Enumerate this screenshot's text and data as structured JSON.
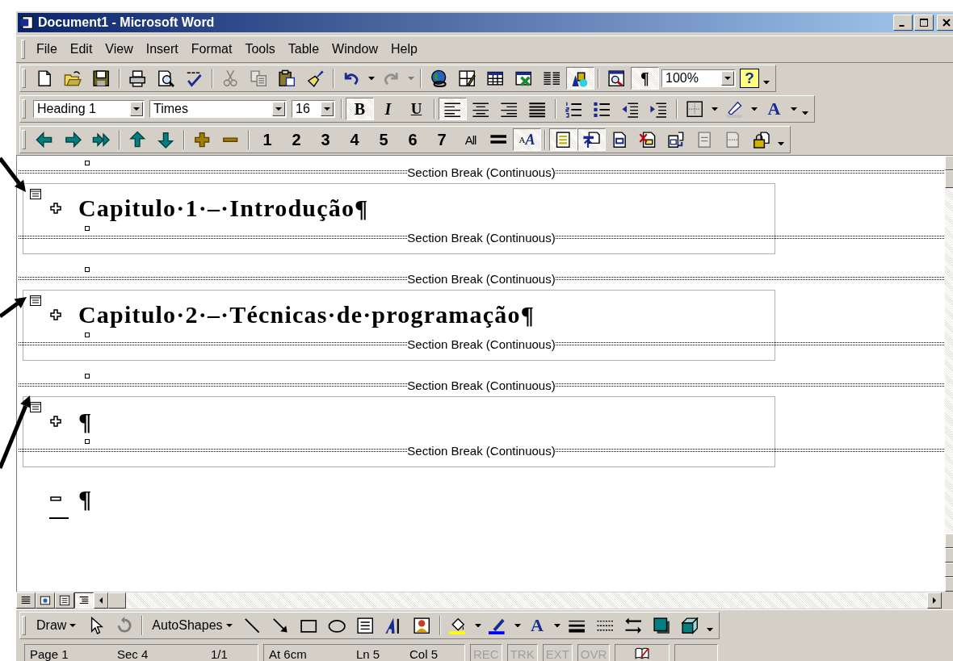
{
  "window": {
    "title": "Document1 - Microsoft Word"
  },
  "menu": [
    "File",
    "Edit",
    "View",
    "Insert",
    "Format",
    "Tools",
    "Table",
    "Window",
    "Help"
  ],
  "toolbars": [
    {
      "kind": "standard",
      "items": [
        {
          "kind": "new",
          "pressed": false,
          "disabled": false
        },
        {
          "kind": "open",
          "pressed": false,
          "disabled": false
        },
        {
          "kind": "save",
          "pressed": false,
          "disabled": false
        },
        {
          "kind": "sep"
        },
        {
          "kind": "print",
          "pressed": false,
          "disabled": false
        },
        {
          "kind": "preview",
          "pressed": false,
          "disabled": false
        },
        {
          "kind": "spell",
          "pressed": false,
          "disabled": false
        },
        {
          "kind": "sep"
        },
        {
          "kind": "cut",
          "pressed": false,
          "disabled": true
        },
        {
          "kind": "copy",
          "pressed": false,
          "disabled": true
        },
        {
          "kind": "paste",
          "pressed": false,
          "disabled": false
        },
        {
          "kind": "painter",
          "pressed": false,
          "disabled": false
        },
        {
          "kind": "sep"
        },
        {
          "kind": "undo",
          "pressed": false,
          "disabled": false
        },
        {
          "kind": "dropdown",
          "pressed": false,
          "disabled": false
        },
        {
          "kind": "redo",
          "pressed": false,
          "disabled": true
        },
        {
          "kind": "dropdown",
          "pressed": false,
          "disabled": true
        },
        {
          "kind": "sep"
        },
        {
          "kind": "web",
          "pressed": false,
          "disabled": false
        },
        {
          "kind": "tables",
          "pressed": false,
          "disabled": false
        },
        {
          "kind": "table",
          "pressed": false,
          "disabled": false
        },
        {
          "kind": "excel",
          "pressed": false,
          "disabled": false
        },
        {
          "kind": "columns",
          "pressed": false,
          "disabled": false
        },
        {
          "kind": "drawing",
          "pressed": true,
          "disabled": false
        },
        {
          "kind": "sep"
        },
        {
          "kind": "docmap",
          "pressed": false,
          "disabled": false
        },
        {
          "kind": "pilcrow",
          "label": "¶",
          "pressed": true,
          "disabled": false
        },
        {
          "kind": "zoom",
          "value": "100%"
        },
        {
          "kind": "help",
          "label": "?",
          "pressed": false,
          "disabled": false
        },
        {
          "kind": "more",
          "pressed": false,
          "disabled": false
        }
      ]
    },
    {
      "kind": "formatting",
      "items": [
        {
          "kind": "style",
          "value": "Heading 1"
        },
        {
          "kind": "font",
          "value": "Times"
        },
        {
          "kind": "size",
          "value": "16"
        },
        {
          "kind": "sep"
        },
        {
          "kind": "bold",
          "label": "B",
          "pressed": true,
          "disabled": false
        },
        {
          "kind": "italic",
          "label": "I",
          "pressed": false,
          "disabled": false
        },
        {
          "kind": "underline",
          "label": "U",
          "pressed": false,
          "disabled": false
        },
        {
          "kind": "sep"
        },
        {
          "kind": "align_left",
          "pressed": true,
          "disabled": false
        },
        {
          "kind": "align_center",
          "pressed": false,
          "disabled": false
        },
        {
          "kind": "align_right",
          "pressed": false,
          "disabled": false
        },
        {
          "kind": "justify",
          "pressed": false,
          "disabled": false
        },
        {
          "kind": "sep"
        },
        {
          "kind": "numbering",
          "pressed": false,
          "disabled": false
        },
        {
          "kind": "bullets",
          "pressed": false,
          "disabled": false
        },
        {
          "kind": "outdent",
          "pressed": false,
          "disabled": false
        },
        {
          "kind": "indent",
          "pressed": false,
          "disabled": false
        },
        {
          "kind": "sep"
        },
        {
          "kind": "border",
          "pressed": false,
          "disabled": false
        },
        {
          "kind": "dropdown",
          "pressed": false,
          "disabled": false
        },
        {
          "kind": "highlight",
          "pressed": false,
          "disabled": false
        },
        {
          "kind": "dropdown",
          "pressed": false,
          "disabled": false
        },
        {
          "kind": "fontcolor",
          "label": "A",
          "pressed": false,
          "disabled": false
        },
        {
          "kind": "dropdown",
          "pressed": false,
          "disabled": false
        },
        {
          "kind": "more",
          "pressed": false,
          "disabled": false
        }
      ]
    },
    {
      "kind": "outlining",
      "items": [
        {
          "kind": "promote",
          "pressed": false,
          "disabled": false
        },
        {
          "kind": "demote",
          "pressed": false,
          "disabled": false
        },
        {
          "kind": "body",
          "pressed": false,
          "disabled": false
        },
        {
          "kind": "sep"
        },
        {
          "kind": "up",
          "pressed": false,
          "disabled": false
        },
        {
          "kind": "down",
          "pressed": false,
          "disabled": false
        },
        {
          "kind": "sep"
        },
        {
          "kind": "expand",
          "pressed": false,
          "disabled": false
        },
        {
          "kind": "collapse",
          "pressed": false,
          "disabled": false
        },
        {
          "kind": "sep"
        },
        {
          "kind": "level",
          "label": "1",
          "pressed": false,
          "disabled": false
        },
        {
          "kind": "level",
          "label": "2",
          "pressed": false,
          "disabled": false
        },
        {
          "kind": "level",
          "label": "3",
          "pressed": false,
          "disabled": false
        },
        {
          "kind": "level",
          "label": "4",
          "pressed": false,
          "disabled": false
        },
        {
          "kind": "level",
          "label": "5",
          "pressed": false,
          "disabled": false
        },
        {
          "kind": "level",
          "label": "6",
          "pressed": false,
          "disabled": false
        },
        {
          "kind": "level",
          "label": "7",
          "pressed": false,
          "disabled": false
        },
        {
          "kind": "all",
          "label": "All",
          "pressed": false,
          "disabled": false
        },
        {
          "kind": "firstline",
          "pressed": false,
          "disabled": false
        },
        {
          "kind": "format",
          "label": "$^{A}$*A*",
          "pressed": true,
          "disabled": false
        },
        {
          "kind": "sep"
        },
        {
          "kind": "master",
          "pressed": true,
          "disabled": false
        },
        {
          "kind": "collapse_sub",
          "pressed": true,
          "disabled": false
        },
        {
          "kind": "create",
          "pressed": false,
          "disabled": false
        },
        {
          "kind": "remove",
          "pressed": false,
          "disabled": false
        },
        {
          "kind": "insert",
          "pressed": false,
          "disabled": false
        },
        {
          "kind": "merge",
          "pressed": false,
          "disabled": true
        },
        {
          "kind": "split",
          "pressed": false,
          "disabled": true
        },
        {
          "kind": "lock",
          "pressed": false,
          "disabled": false
        },
        {
          "kind": "more",
          "pressed": false,
          "disabled": false
        }
      ]
    },
    {
      "kind": "drawing",
      "items": [
        {
          "kind": "menu",
          "label": "Draw"
        },
        {
          "kind": "pointer",
          "pressed": false,
          "disabled": false
        },
        {
          "kind": "rotate",
          "pressed": false,
          "disabled": true
        },
        {
          "kind": "sep"
        },
        {
          "kind": "menu",
          "label": "AutoShapes"
        },
        {
          "kind": "line",
          "pressed": false,
          "disabled": false
        },
        {
          "kind": "arrow",
          "pressed": false,
          "disabled": false
        },
        {
          "kind": "rect",
          "pressed": false,
          "disabled": false
        },
        {
          "kind": "oval",
          "pressed": false,
          "disabled": false
        },
        {
          "kind": "textbox",
          "pressed": false,
          "disabled": false
        },
        {
          "kind": "wordart",
          "pressed": false,
          "disabled": false
        },
        {
          "kind": "clipart",
          "pressed": false,
          "disabled": false
        },
        {
          "kind": "sep"
        },
        {
          "kind": "fill",
          "pressed": false,
          "disabled": false
        },
        {
          "kind": "dropdown",
          "pressed": false,
          "disabled": false
        },
        {
          "kind": "linecolor",
          "pressed": false,
          "disabled": false
        },
        {
          "kind": "dropdown",
          "pressed": false,
          "disabled": false
        },
        {
          "kind": "fontcolor",
          "label": "A",
          "pressed": false,
          "disabled": false
        },
        {
          "kind": "dropdown",
          "pressed": false,
          "disabled": false
        },
        {
          "kind": "linestyle",
          "pressed": false,
          "disabled": false
        },
        {
          "kind": "dash",
          "pressed": false,
          "disabled": false
        },
        {
          "kind": "arrowstyle",
          "pressed": false,
          "disabled": false
        },
        {
          "kind": "shadow",
          "pressed": false,
          "disabled": false
        },
        {
          "kind": "cube",
          "pressed": false,
          "disabled": false
        },
        {
          "kind": "more",
          "pressed": false,
          "disabled": false
        }
      ]
    }
  ],
  "document": {
    "items": [
      {
        "kind": "section_break",
        "label": "Section Break (Continuous)"
      },
      {
        "kind": "subdocument",
        "children": [
          {
            "kind": "heading",
            "text": "Capitulo·1·–·Introdução¶",
            "has_subtext": true
          },
          {
            "kind": "section_break",
            "label": "Section Break (Continuous)"
          }
        ]
      },
      {
        "kind": "section_break",
        "label": "Section Break (Continuous)"
      },
      {
        "kind": "subdocument",
        "children": [
          {
            "kind": "heading",
            "text": "Capitulo·2·–·Técnicas·de·programação¶",
            "has_subtext": true
          },
          {
            "kind": "section_break",
            "label": "Section Break (Continuous)"
          }
        ]
      },
      {
        "kind": "section_break",
        "label": "Section Break (Continuous)"
      },
      {
        "kind": "subdocument",
        "children": [
          {
            "kind": "heading",
            "text": "¶",
            "has_subtext": true
          },
          {
            "kind": "section_break",
            "label": "Section Break (Continuous)"
          }
        ]
      },
      {
        "kind": "heading",
        "text": "¶",
        "has_subtext": false
      }
    ]
  },
  "view_buttons": [
    {
      "kind": "normal",
      "selected": false
    },
    {
      "kind": "web",
      "selected": false
    },
    {
      "kind": "print",
      "selected": false
    },
    {
      "kind": "outline",
      "selected": true
    }
  ],
  "status_bar": {
    "panels": [
      [
        "Page 1",
        "Sec 4",
        "1/1"
      ],
      [
        "At 6cm",
        "Ln 5",
        "Col 5"
      ]
    ],
    "modes": [
      {
        "label": "REC",
        "active": false
      },
      {
        "label": "TRK",
        "active": false
      },
      {
        "label": "EXT",
        "active": false
      },
      {
        "label": "OVR",
        "active": false
      }
    ]
  }
}
